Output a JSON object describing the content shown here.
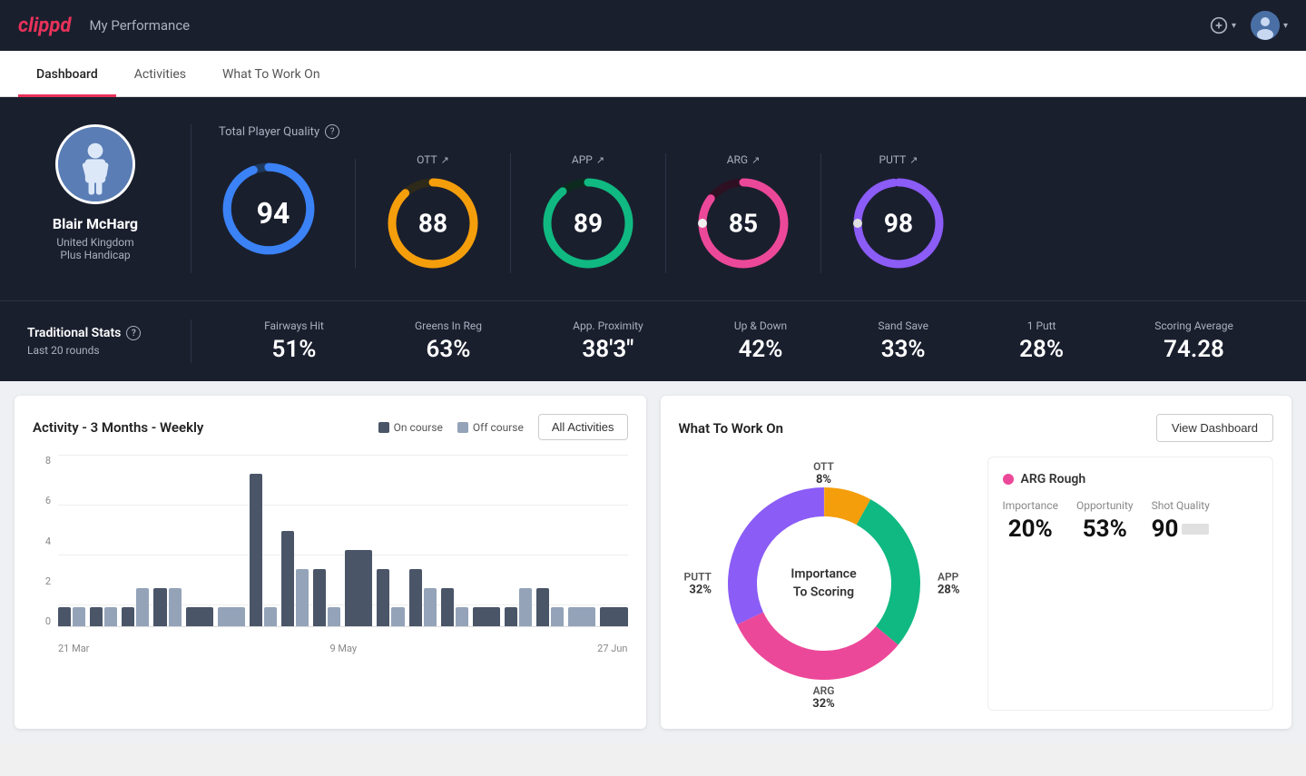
{
  "app": {
    "logo": "clippd",
    "header_title": "My Performance"
  },
  "nav": {
    "tabs": [
      {
        "id": "dashboard",
        "label": "Dashboard",
        "active": true
      },
      {
        "id": "activities",
        "label": "Activities",
        "active": false
      },
      {
        "id": "what-to-work-on",
        "label": "What To Work On",
        "active": false
      }
    ]
  },
  "player": {
    "name": "Blair McHarg",
    "country": "United Kingdom",
    "handicap": "Plus Handicap"
  },
  "quality": {
    "section_label": "Total Player Quality",
    "gauges": [
      {
        "id": "total",
        "label": "",
        "value": "94",
        "color": "#3b82f6",
        "trail": "#1e3a5f",
        "pct": 94
      },
      {
        "id": "ott",
        "label": "OTT",
        "value": "88",
        "color": "#f59e0b",
        "trail": "#2d2a1a",
        "pct": 88
      },
      {
        "id": "app",
        "label": "APP",
        "value": "89",
        "color": "#10b981",
        "trail": "#0d2a1f",
        "pct": 89
      },
      {
        "id": "arg",
        "label": "ARG",
        "value": "85",
        "color": "#ec4899",
        "trail": "#2d1022",
        "pct": 85
      },
      {
        "id": "putt",
        "label": "PUTT",
        "value": "98",
        "color": "#8b5cf6",
        "trail": "#1e1040",
        "pct": 98
      }
    ]
  },
  "trad_stats": {
    "label": "Traditional Stats",
    "sublabel": "Last 20 rounds",
    "items": [
      {
        "label": "Fairways Hit",
        "value": "51%"
      },
      {
        "label": "Greens In Reg",
        "value": "63%"
      },
      {
        "label": "App. Proximity",
        "value": "38'3\""
      },
      {
        "label": "Up & Down",
        "value": "42%"
      },
      {
        "label": "Sand Save",
        "value": "33%"
      },
      {
        "label": "1 Putt",
        "value": "28%"
      },
      {
        "label": "Scoring Average",
        "value": "74.28"
      }
    ]
  },
  "activity_chart": {
    "title": "Activity - 3 Months - Weekly",
    "legend": {
      "on_course": "On course",
      "off_course": "Off course"
    },
    "all_activities_btn": "All Activities",
    "y_labels": [
      "8",
      "6",
      "4",
      "2",
      "0"
    ],
    "x_labels": [
      "21 Mar",
      "9 May",
      "27 Jun"
    ],
    "bars": [
      {
        "on": 1,
        "off": 1
      },
      {
        "on": 1,
        "off": 1
      },
      {
        "on": 1,
        "off": 2
      },
      {
        "on": 2,
        "off": 2
      },
      {
        "on": 1,
        "off": 0
      },
      {
        "on": 0,
        "off": 1
      },
      {
        "on": 8,
        "off": 1
      },
      {
        "on": 5,
        "off": 3
      },
      {
        "on": 3,
        "off": 1
      },
      {
        "on": 4,
        "off": 0
      },
      {
        "on": 3,
        "off": 1
      },
      {
        "on": 3,
        "off": 2
      },
      {
        "on": 2,
        "off": 1
      },
      {
        "on": 1,
        "off": 0
      },
      {
        "on": 1,
        "off": 2
      },
      {
        "on": 2,
        "off": 1
      },
      {
        "on": 0,
        "off": 1
      },
      {
        "on": 1,
        "off": 0
      }
    ],
    "max_val": 9
  },
  "what_to_work_on": {
    "title": "What To Work On",
    "view_dashboard_btn": "View Dashboard",
    "donut_center": "Importance\nTo Scoring",
    "segments": [
      {
        "label": "OTT",
        "pct": "8%",
        "color": "#f59e0b",
        "pos": "top"
      },
      {
        "label": "APP",
        "pct": "28%",
        "color": "#10b981",
        "pos": "right"
      },
      {
        "label": "ARG",
        "pct": "32%",
        "color": "#ec4899",
        "pos": "bottom"
      },
      {
        "label": "PUTT",
        "pct": "32%",
        "color": "#8b5cf6",
        "pos": "left"
      }
    ],
    "card": {
      "title": "ARG Rough",
      "dot_color": "#ec4899",
      "metrics": [
        {
          "label": "Importance",
          "value": "20%"
        },
        {
          "label": "Opportunity",
          "value": "53%"
        },
        {
          "label": "Shot Quality",
          "value": "90"
        }
      ]
    }
  }
}
